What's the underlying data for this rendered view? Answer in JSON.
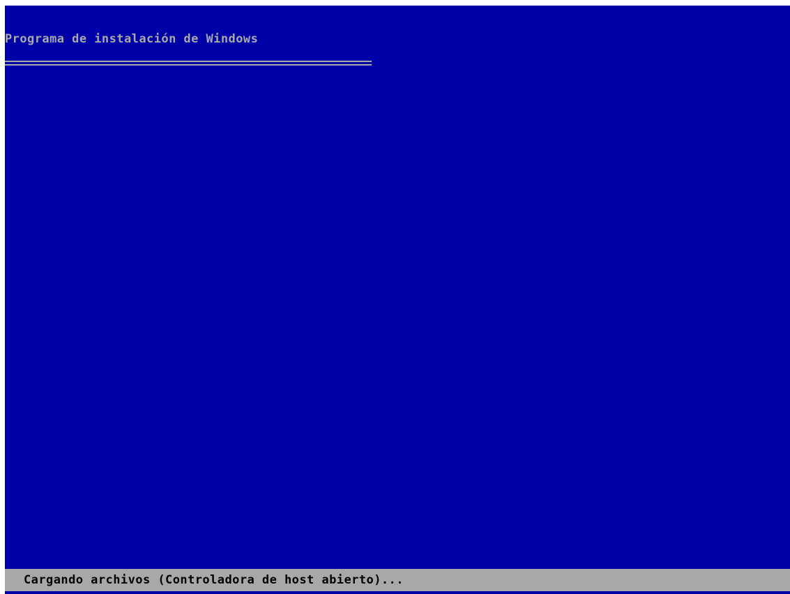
{
  "setup": {
    "title": "Programa de instalación de Windows"
  },
  "status_bar": {
    "text": "Cargando archivos (Controladora de host abierto)..."
  },
  "colors": {
    "background": "#0000a8",
    "title_text": "#a8a8a8",
    "status_bar_background": "#a8a8a8",
    "status_text": "#000000"
  }
}
